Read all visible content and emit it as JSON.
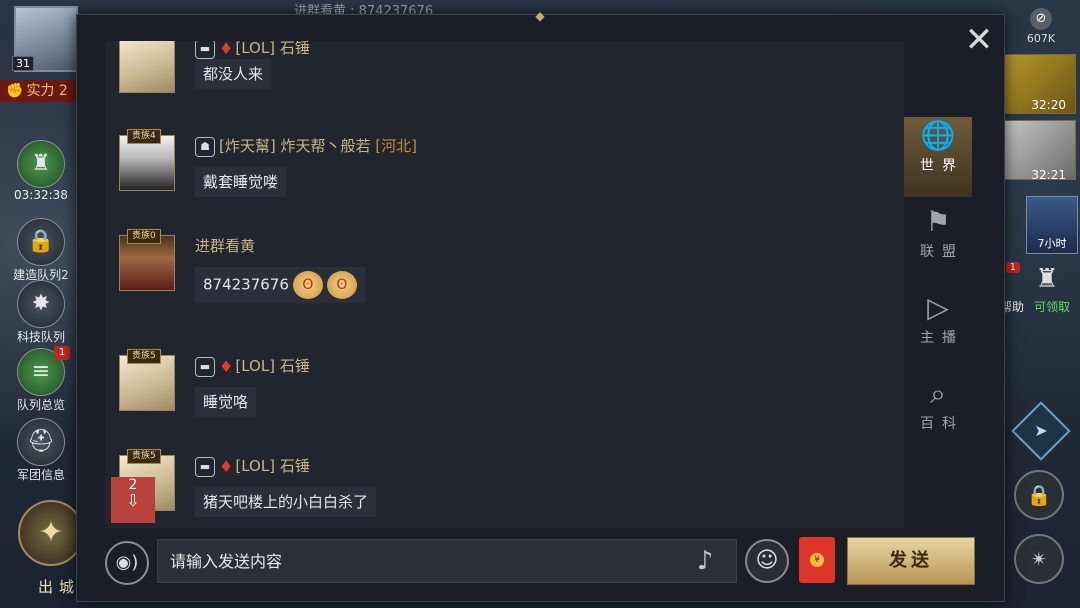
{
  "hud": {
    "level": "31",
    "power_label": "实力 2",
    "left_buttons": [
      {
        "label": "03:32:38",
        "icon": "castle-icon"
      },
      {
        "label": "建造队列2",
        "icon": "lock-icon"
      },
      {
        "label": "科技队列",
        "icon": "tech-icon"
      },
      {
        "label": "队列总览",
        "icon": "queue-icon",
        "badge": "1"
      },
      {
        "label": "军团信息",
        "icon": "helmet-icon"
      }
    ],
    "compass_label": "出城",
    "currency_value": "607K",
    "right_timer_1": "32:20",
    "right_timer_2": "32:21",
    "castle_label": "7小时",
    "help_label": "帮助",
    "help_badge": "1",
    "claim_label": "可领取",
    "top_strip_text": "进群看黄 : 874237676"
  },
  "chat": {
    "messages": [
      {
        "avatar": "blond",
        "rank": "",
        "tag": "[LOL]",
        "name": "石锤",
        "location": "",
        "has_flag": true,
        "text": "都没人来",
        "emojis": 0
      },
      {
        "avatar": "man",
        "rank": "贵族4",
        "tag": "[炸天幫]",
        "name": "炸天帮丶般若",
        "location": "[河北]",
        "has_flag": false,
        "text": "戴套睡觉喽",
        "emojis": 0
      },
      {
        "avatar": "warrior",
        "rank": "贵族0",
        "tag": "",
        "name": "进群看黄",
        "location": "",
        "has_flag": false,
        "text": "874237676",
        "emojis": 2
      },
      {
        "avatar": "blond",
        "rank": "贵族5",
        "tag": "[LOL]",
        "name": "石锤",
        "location": "",
        "has_flag": true,
        "text": "睡觉咯",
        "emojis": 0
      },
      {
        "avatar": "blond",
        "rank": "贵族5",
        "tag": "[LOL]",
        "name": "石锤",
        "location": "",
        "has_flag": true,
        "text": "猪天吧楼上的小白白杀了",
        "emojis": 0
      }
    ],
    "unread_count": "2"
  },
  "tabs": [
    {
      "label": "世界",
      "icon": "globe-chat-icon",
      "active": true
    },
    {
      "label": "联盟",
      "icon": "alliance-chat-icon",
      "active": false
    },
    {
      "label": "主播",
      "icon": "play-icon",
      "active": false
    },
    {
      "label": "百科",
      "icon": "encyclopedia-icon",
      "active": false
    }
  ],
  "input": {
    "placeholder": "请输入发送内容"
  },
  "send_label": "发送",
  "colors": {
    "accent_gold": "#c9b48a",
    "location_orange": "#c98a3a",
    "redpack": "#e0352b",
    "unread_red": "#b8423c"
  }
}
